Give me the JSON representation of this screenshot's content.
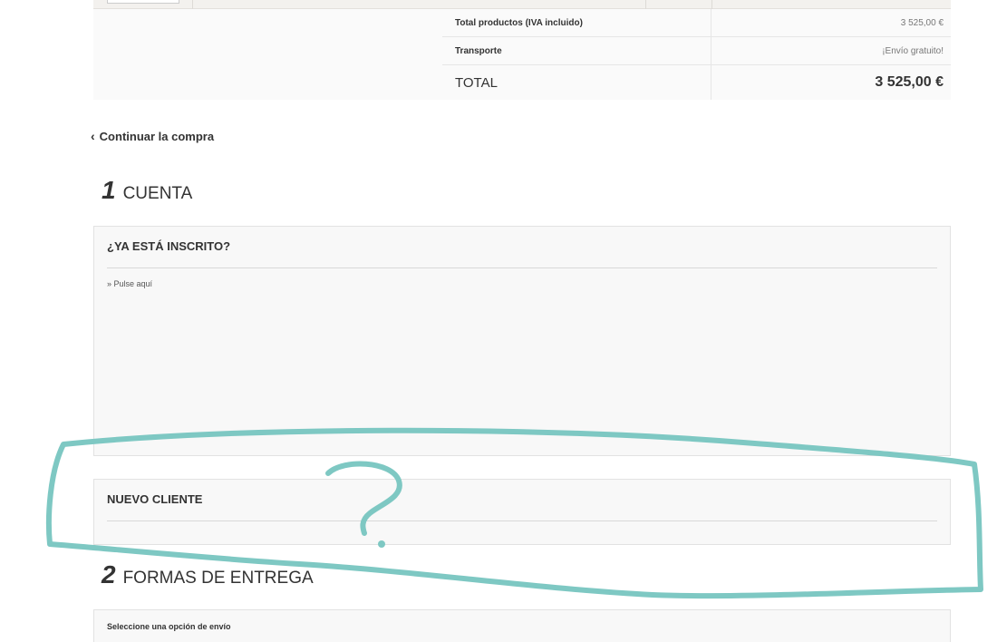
{
  "summary": {
    "total_products_label": "Total productos (IVA incluido)",
    "total_products_value": "3 525,00 €",
    "shipping_label": "Transporte",
    "shipping_value": "¡Envío gratuito!",
    "total_label": "TOTAL",
    "total_value": "3 525,00 €"
  },
  "continue_shopping": {
    "icon": "chevron-left-icon",
    "label": "Continuar la compra"
  },
  "step1": {
    "number": "1",
    "title": "CUENTA",
    "login_panel": {
      "heading": "¿YA ESTÁ INSCRITO?",
      "link": "» Pulse aquí"
    },
    "new_customer_panel": {
      "heading": "NUEVO CLIENTE"
    }
  },
  "step2": {
    "number": "2",
    "title": "FORMAS DE ENTREGA",
    "shipping_panel": {
      "heading": "Seleccione una opción de envío"
    }
  },
  "annotation": {
    "mark": "?",
    "color": "#7ec8c3"
  }
}
